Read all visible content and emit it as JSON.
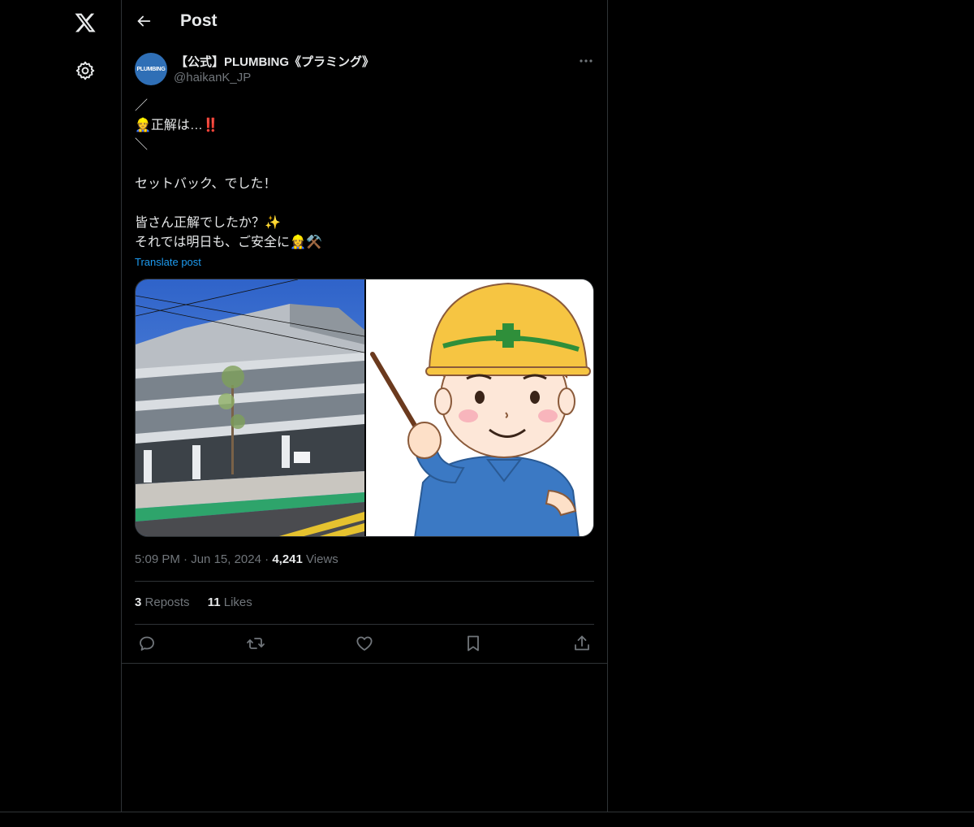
{
  "header": {
    "title": "Post"
  },
  "author": {
    "display_name": "【公式】PLUMBING《プラミング》",
    "handle": "@haikanK_JP",
    "avatar_text": "PLUMBING"
  },
  "tweet": {
    "text": "／\n👷正解は…‼️\n＼\n\nセットバック、でした！\n\n皆さん正解でしたか？✨\nそれでは明日も、ご安全に👷‍♀️⚒️",
    "translate_label": "Translate post"
  },
  "meta": {
    "time": "5:09 PM",
    "separator": "·",
    "date": "Jun 15, 2024",
    "views_count": "4,241",
    "views_label": "Views"
  },
  "stats": {
    "reposts_count": "3",
    "reposts_label": "Reposts",
    "likes_count": "11",
    "likes_label": "Likes"
  },
  "icons": {
    "logo": "x-logo-icon",
    "settings": "gear-icon",
    "back": "arrow-left-icon",
    "more": "more-dots-icon",
    "reply": "reply-icon",
    "repost": "repost-icon",
    "like": "heart-icon",
    "bookmark": "bookmark-icon",
    "share": "share-icon"
  },
  "colors": {
    "background": "#000000",
    "border": "#2f3336",
    "link": "#1d9bf0",
    "text_primary": "#e7e9ea",
    "text_secondary": "#71767b"
  }
}
